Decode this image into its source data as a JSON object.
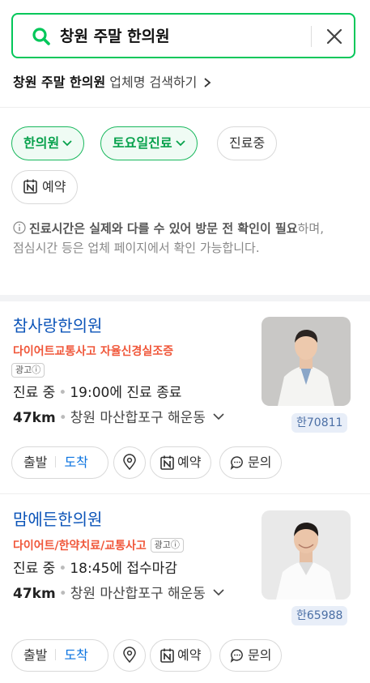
{
  "search": {
    "query": "창원 주말 한의원"
  },
  "biz_search": {
    "query": "창원 주말 한의원",
    "suffix": "업체명 검색하기"
  },
  "filters": [
    {
      "label": "한의원",
      "active": true,
      "has_caret": true
    },
    {
      "label": "토요일진료",
      "active": true,
      "has_caret": true
    },
    {
      "label": "진료중",
      "active": false,
      "has_caret": false
    },
    {
      "label": "예약",
      "active": false,
      "has_caret": false
    }
  ],
  "notice": {
    "bold": "진료시간은 실제와 다를 수 있어 방문 전 확인이 필요",
    "rest": "하며, 점심시간 등은 업체 페이지에서 확인 가능합니다."
  },
  "results": [
    {
      "name": "참사랑한의원",
      "tags": "다이어트교통사고 자율신경실조증",
      "ad_label": "광고ⓘ",
      "status": "진료 중",
      "time": "19:00",
      "time_suffix": "에 진료 종료",
      "distance": "47km",
      "address": "창원 마산합포구 해운동",
      "badge": "한70811"
    },
    {
      "name": "맘에든한의원",
      "tags": "다이어트/한약치료/교통사고",
      "ad_label": "광고ⓘ",
      "status": "진료 중",
      "time": "18:45",
      "time_suffix": "에 접수마감",
      "distance": "47km",
      "address": "창원 마산합포구 해운동",
      "badge": "한65988"
    }
  ],
  "actions": {
    "depart": "출발",
    "arrive": "도착",
    "reserve": "예약",
    "inquire": "문의"
  },
  "colors": {
    "accent": "#03c75a",
    "link": "#0a53b8",
    "tag": "#f0573a",
    "arrive": "#0a73e0"
  }
}
